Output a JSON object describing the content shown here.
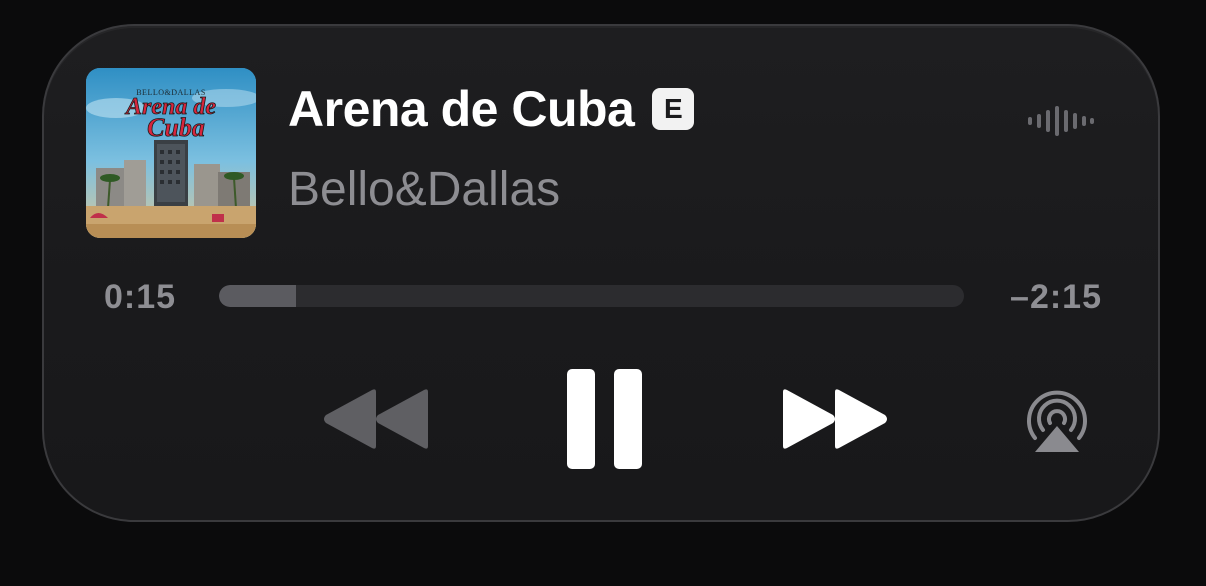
{
  "now_playing": {
    "title": "Arena de Cuba",
    "explicit_badge": "E",
    "artist": "Bello&Dallas",
    "artwork": {
      "label": "BELLO&DALLAS",
      "title_line1": "Arena de",
      "title_line2": "Cuba"
    }
  },
  "progress": {
    "elapsed": "0:15",
    "remaining": "–2:15",
    "fraction": 0.103
  },
  "controls": {
    "rewind": "backward-icon",
    "pause": "pause-icon",
    "forward": "forward-icon",
    "airplay": "airplay-icon"
  },
  "colors": {
    "background": "#0b0b0c",
    "panel": "#1c1c1e",
    "title": "#ffffff",
    "artist": "#8d8d92",
    "track": "#2c2c2f",
    "fill": "#5b5b60",
    "rewind_disabled": "#5f5f63",
    "active_control": "#ffffff"
  }
}
